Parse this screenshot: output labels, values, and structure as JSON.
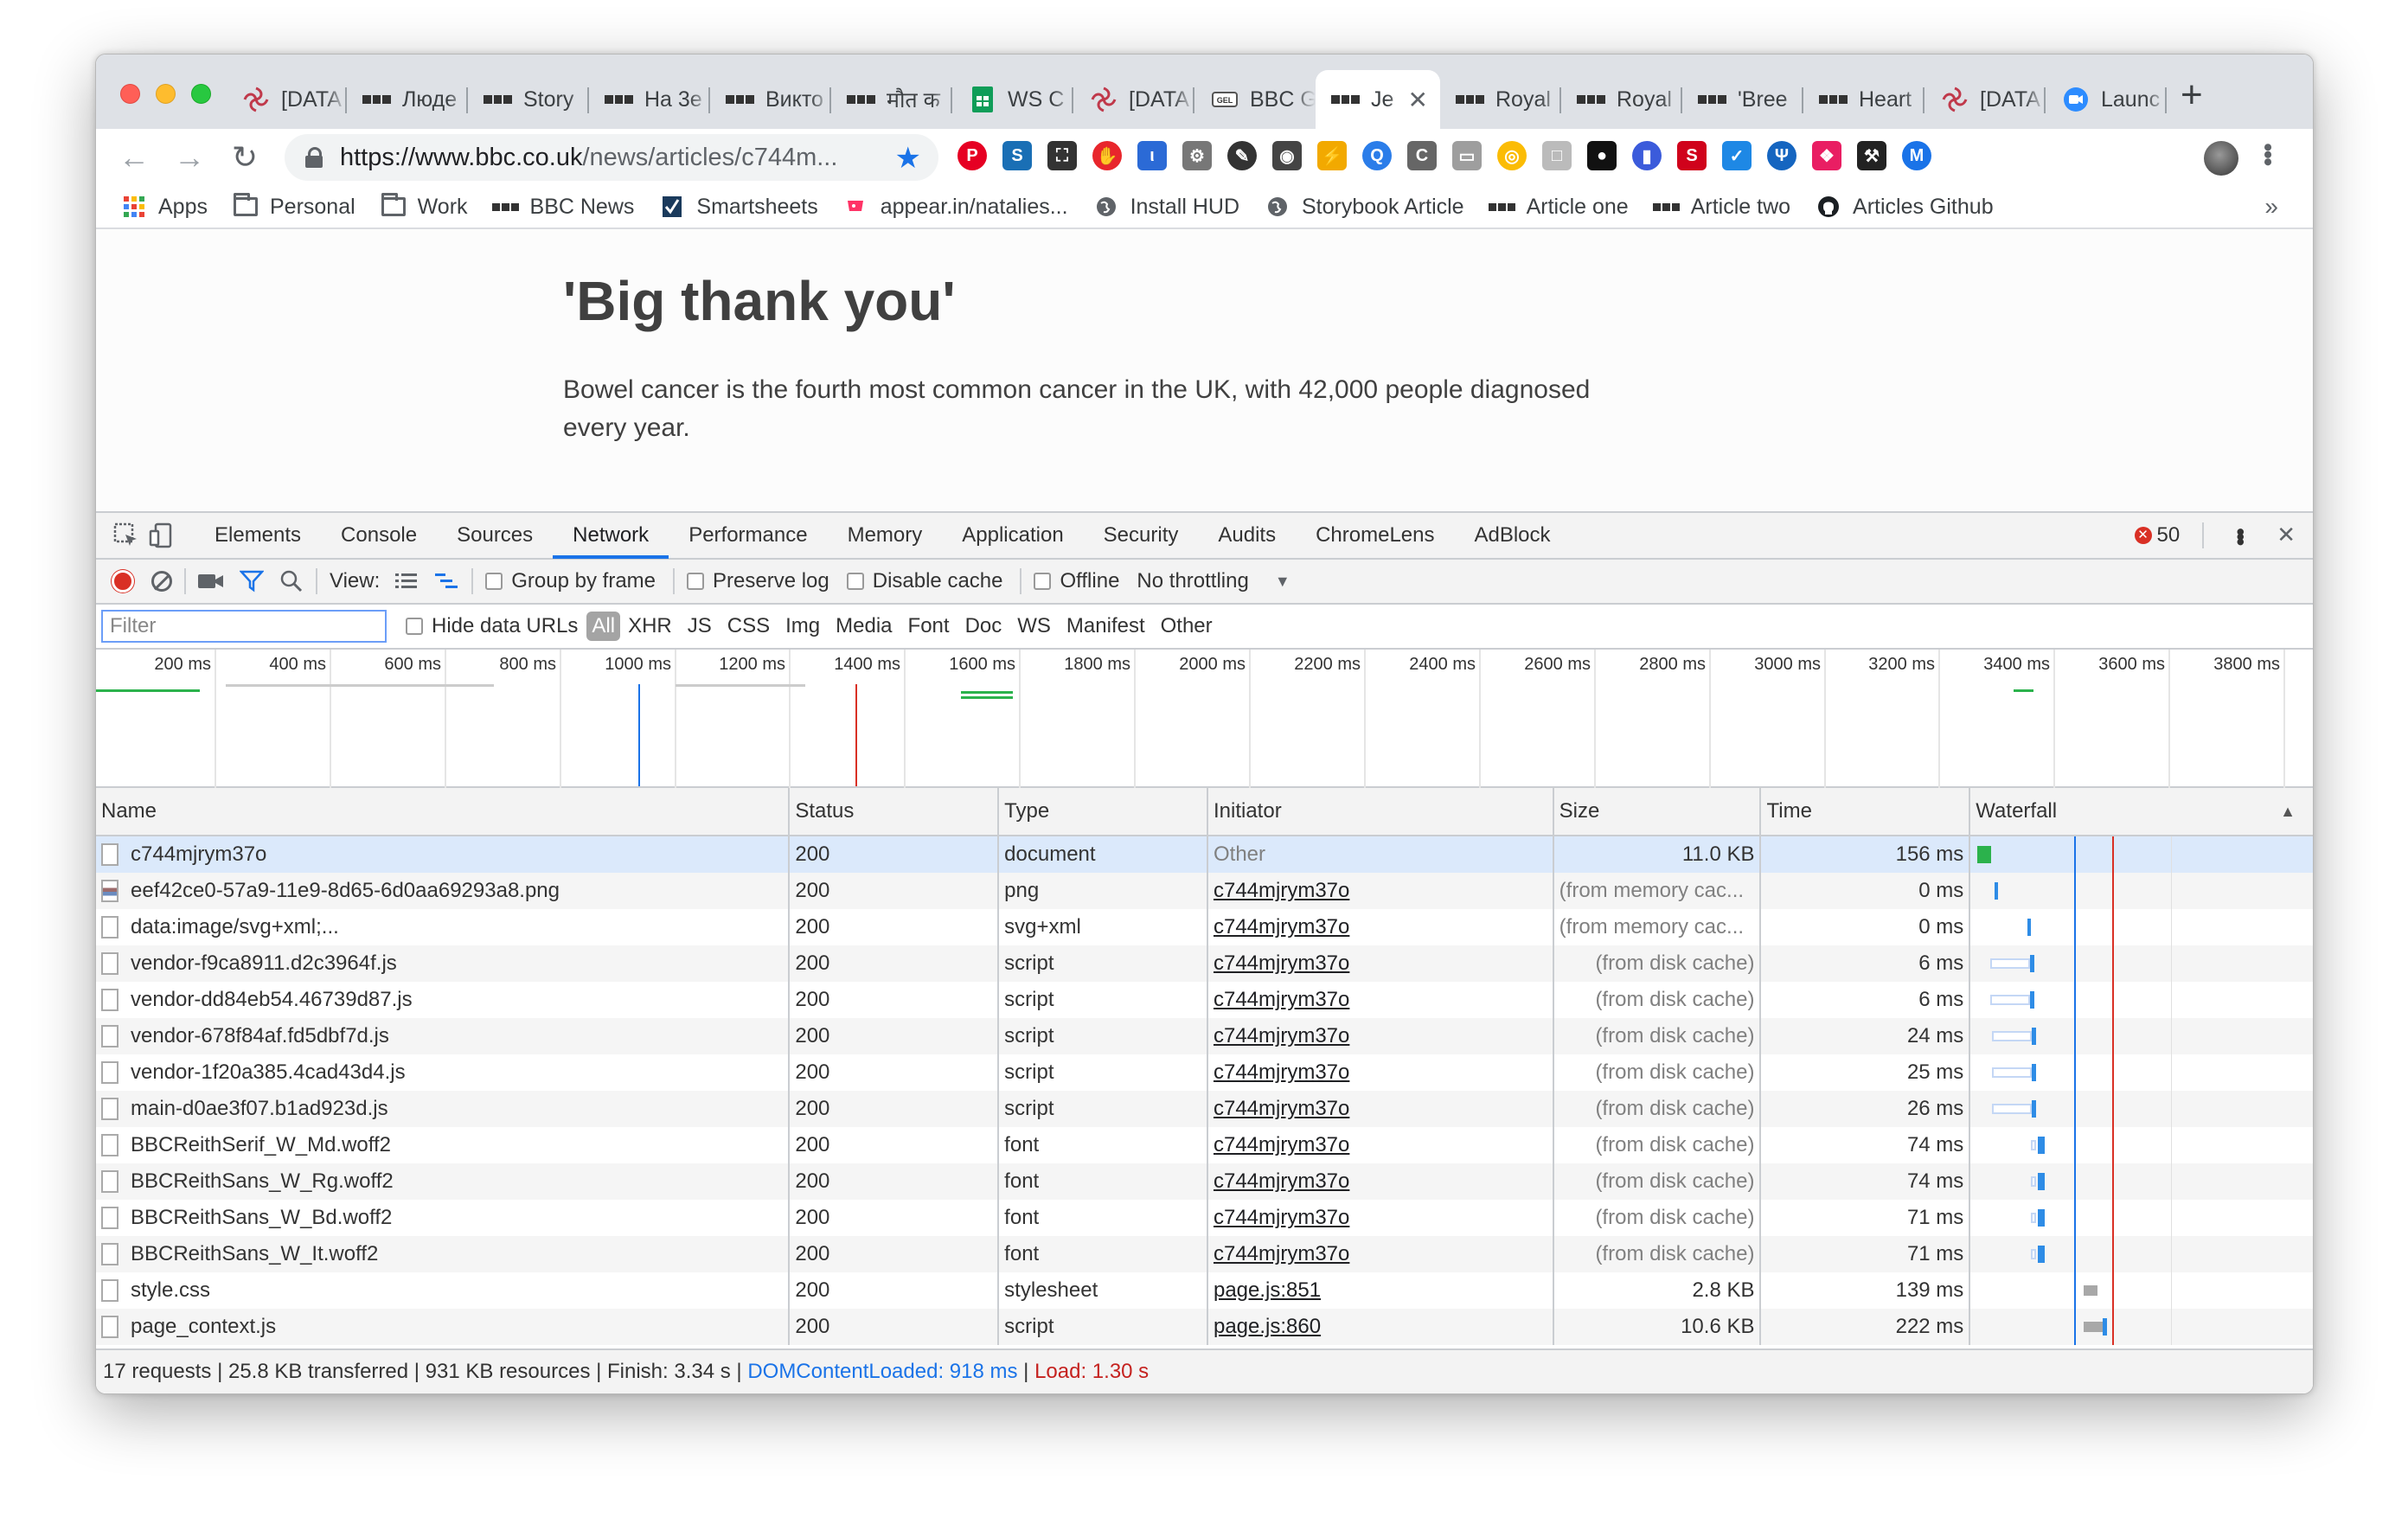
{
  "window": {
    "tabs": [
      {
        "title": "[DATA",
        "favicon": "swirl-icon",
        "color": "#c0394b"
      },
      {
        "title": "Люде",
        "favicon": "bbc-icon"
      },
      {
        "title": "Story",
        "favicon": "bbc-icon"
      },
      {
        "title": "На 3е",
        "favicon": "bbc-icon"
      },
      {
        "title": "Викто",
        "favicon": "bbc-icon"
      },
      {
        "title": "मौत क",
        "favicon": "bbc-icon"
      },
      {
        "title": "WS C",
        "favicon": "sheets-icon",
        "color": "#0f9d58"
      },
      {
        "title": "[DATA",
        "favicon": "swirl-icon",
        "color": "#c0394b"
      },
      {
        "title": "BBC G",
        "favicon": "gel-icon"
      },
      {
        "title": "Je",
        "favicon": "bbc-icon",
        "active": true
      },
      {
        "title": "Royal",
        "favicon": "bbc-icon"
      },
      {
        "title": "Royal",
        "favicon": "bbc-icon"
      },
      {
        "title": "'Bree",
        "favicon": "bbc-icon"
      },
      {
        "title": "Heart",
        "favicon": "bbc-icon"
      },
      {
        "title": "[DATA",
        "favicon": "swirl-icon",
        "color": "#c0394b"
      },
      {
        "title": "Launc",
        "favicon": "zoom-icon",
        "color": "#2d8cff"
      }
    ],
    "new_tab": "+"
  },
  "toolbar": {
    "back": "←",
    "forward": "→",
    "reload": "↻",
    "url_host": "https://www.bbc.co.uk",
    "url_path": "/news/articles/c744m...",
    "star": "★",
    "extensions": [
      {
        "name": "pinterest-icon",
        "color": "#e60023",
        "glyph": "P"
      },
      {
        "name": "s-extension-icon",
        "color": "#1a6fb5",
        "glyph": "S"
      },
      {
        "name": "screenshot-icon",
        "color": "#333333",
        "glyph": "⛶"
      },
      {
        "name": "adblock-hand-icon",
        "color": "#e8262c",
        "glyph": "✋"
      },
      {
        "name": "lang-extension-icon",
        "color": "#2b6ad6",
        "glyph": "ι"
      },
      {
        "name": "gear-extension-icon",
        "color": "#777777",
        "glyph": "⚙"
      },
      {
        "name": "eyedropper-icon",
        "color": "#333333",
        "glyph": "✎"
      },
      {
        "name": "incognito-icon",
        "color": "#444444",
        "glyph": "◉"
      },
      {
        "name": "lightning-icon",
        "color": "#f2a900",
        "glyph": "⚡"
      },
      {
        "name": "search-extension-icon",
        "color": "#2b7de9",
        "glyph": "Q"
      },
      {
        "name": "c-extension-icon",
        "color": "#666666",
        "glyph": "C"
      },
      {
        "name": "chat-extension-icon",
        "color": "#9e9e9e",
        "glyph": "▭"
      },
      {
        "name": "chrome-icon",
        "color": "#fbbc05",
        "glyph": "◎"
      },
      {
        "name": "box-extension-icon",
        "color": "#bbbbbb",
        "glyph": "□"
      },
      {
        "name": "mask-extension-icon",
        "color": "#111111",
        "glyph": "●"
      },
      {
        "name": "bookmark-flag-icon",
        "color": "#3b5bdb",
        "glyph": "▮"
      },
      {
        "name": "seo-icon",
        "color": "#d0021b",
        "glyph": "S"
      },
      {
        "name": "check-circle-icon",
        "color": "#1e88e5",
        "glyph": "✓"
      },
      {
        "name": "tree-extension-icon",
        "color": "#1565c0",
        "glyph": "Ψ"
      },
      {
        "name": "color-wheel-icon",
        "color": "#e91e63",
        "glyph": "❖"
      },
      {
        "name": "fork-extension-icon",
        "color": "#222222",
        "glyph": "⚒"
      },
      {
        "name": "m-extension-icon",
        "color": "#1a73e8",
        "glyph": "M"
      }
    ]
  },
  "bookmarks": [
    {
      "label": "Apps",
      "icon": "apps-grid-icon"
    },
    {
      "label": "Personal",
      "icon": "folder-icon"
    },
    {
      "label": "Work",
      "icon": "folder-icon"
    },
    {
      "label": "BBC News",
      "icon": "bbc-icon"
    },
    {
      "label": "Smartsheets",
      "icon": "smartsheet-icon"
    },
    {
      "label": "appear.in/natalies...",
      "icon": "appear-in-icon"
    },
    {
      "label": "Install HUD",
      "icon": "globe-icon"
    },
    {
      "label": "Storybook Article",
      "icon": "globe-icon"
    },
    {
      "label": "Article one",
      "icon": "bbc-icon"
    },
    {
      "label": "Article two",
      "icon": "bbc-icon"
    },
    {
      "label": "Articles Github",
      "icon": "github-icon"
    }
  ],
  "bookmarks_more": "»",
  "page": {
    "headline": "'Big thank you'",
    "paragraph": "Bowel cancer is the fourth most common cancer in the UK, with 42,000 people diagnosed every year."
  },
  "devtools": {
    "tabs": [
      "Elements",
      "Console",
      "Sources",
      "Network",
      "Performance",
      "Memory",
      "Application",
      "Security",
      "Audits",
      "ChromeLens",
      "AdBlock"
    ],
    "active_tab": "Network",
    "error_count": "50",
    "error_glyph": "✕",
    "close": "✕",
    "view_label": "View:",
    "options": {
      "group_by_frame": "Group by frame",
      "preserve_log": "Preserve log",
      "disable_cache": "Disable cache",
      "offline": "Offline",
      "throttling": "No throttling"
    },
    "filter_placeholder": "Filter",
    "hide_data_urls": "Hide data URLs",
    "filter_types": [
      "All",
      "XHR",
      "JS",
      "CSS",
      "Img",
      "Media",
      "Font",
      "Doc",
      "WS",
      "Manifest",
      "Other"
    ],
    "overview_ticks": [
      "200 ms",
      "400 ms",
      "600 ms",
      "800 ms",
      "1000 ms",
      "1200 ms",
      "1400 ms",
      "1600 ms",
      "1800 ms",
      "2000 ms",
      "2200 ms",
      "2400 ms",
      "2600 ms",
      "2800 ms",
      "3000 ms",
      "3200 ms",
      "3400 ms",
      "3600 ms",
      "3800 ms"
    ],
    "columns": [
      "Name",
      "Status",
      "Type",
      "Initiator",
      "Size",
      "Time",
      "Waterfall"
    ],
    "sort_glyph": "▲",
    "rows": [
      {
        "name": "c744mjrym37o",
        "status": "200",
        "type": "document",
        "initiator": "Other",
        "size": "11.0 KB",
        "time": "156 ms",
        "initiator_link": false,
        "icon": "file-icon",
        "wf_start": 0.0,
        "wf_end": 0.0395,
        "wf_color": "#2bb24c"
      },
      {
        "name": "eef42ce0-57a9-11e9-8d65-6d0aa69293a8.png",
        "status": "200",
        "type": "png",
        "initiator": "c744mjrym37o",
        "size": "(from memory cac...",
        "time": "0 ms",
        "initiator_link": true,
        "icon": "image-file-icon",
        "wf_start": 0.0505,
        "wf_end": 0.0515,
        "wf_color": "#2e8ce6"
      },
      {
        "name": "data:image/svg+xml;...",
        "status": "200",
        "type": "svg+xml",
        "initiator": "c744mjrym37o",
        "size": "(from memory cac...",
        "time": "0 ms",
        "initiator_link": true,
        "icon": "file-icon",
        "wf_start": 0.146,
        "wf_end": 0.147,
        "wf_color": "#2e8ce6"
      },
      {
        "name": "vendor-f9ca8911.d2c3964f.js",
        "status": "200",
        "type": "script",
        "initiator": "c744mjrym37o",
        "size": "(from disk cache)",
        "time": "6 ms",
        "initiator_link": true,
        "icon": "file-icon",
        "wf_start": 0.154,
        "wf_end": 0.155,
        "wf_color": "#2e8ce6"
      },
      {
        "name": "vendor-dd84eb54.46739d87.js",
        "status": "200",
        "type": "script",
        "initiator": "c744mjrym37o",
        "size": "(from disk cache)",
        "time": "6 ms",
        "initiator_link": true,
        "icon": "file-icon",
        "wf_start": 0.154,
        "wf_end": 0.155,
        "wf_color": "#2e8ce6"
      },
      {
        "name": "vendor-678f84af.fd5dbf7d.js",
        "status": "200",
        "type": "script",
        "initiator": "c744mjrym37o",
        "size": "(from disk cache)",
        "time": "24 ms",
        "initiator_link": true,
        "icon": "file-icon",
        "wf_start": 0.16,
        "wf_end": 0.166,
        "wf_color": "#2e8ce6"
      },
      {
        "name": "vendor-1f20a385.4cad43d4.js",
        "status": "200",
        "type": "script",
        "initiator": "c744mjrym37o",
        "size": "(from disk cache)",
        "time": "25 ms",
        "initiator_link": true,
        "icon": "file-icon",
        "wf_start": 0.16,
        "wf_end": 0.166,
        "wf_color": "#2e8ce6"
      },
      {
        "name": "main-d0ae3f07.b1ad923d.js",
        "status": "200",
        "type": "script",
        "initiator": "c744mjrym37o",
        "size": "(from disk cache)",
        "time": "26 ms",
        "initiator_link": true,
        "icon": "file-icon",
        "wf_start": 0.16,
        "wf_end": 0.166,
        "wf_color": "#2e8ce6"
      },
      {
        "name": "BBCReithSerif_W_Md.woff2",
        "status": "200",
        "type": "font",
        "initiator": "c744mjrym37o",
        "size": "(from disk cache)",
        "time": "74 ms",
        "initiator_link": true,
        "icon": "file-icon",
        "wf_start": 0.166,
        "wf_end": 0.185,
        "wf_color": "#2e8ce6"
      },
      {
        "name": "BBCReithSans_W_Rg.woff2",
        "status": "200",
        "type": "font",
        "initiator": "c744mjrym37o",
        "size": "(from disk cache)",
        "time": "74 ms",
        "initiator_link": true,
        "icon": "file-icon",
        "wf_start": 0.166,
        "wf_end": 0.185,
        "wf_color": "#2e8ce6"
      },
      {
        "name": "BBCReithSans_W_Bd.woff2",
        "status": "200",
        "type": "font",
        "initiator": "c744mjrym37o",
        "size": "(from disk cache)",
        "time": "71 ms",
        "initiator_link": true,
        "icon": "file-icon",
        "wf_start": 0.166,
        "wf_end": 0.184,
        "wf_color": "#2e8ce6"
      },
      {
        "name": "BBCReithSans_W_It.woff2",
        "status": "200",
        "type": "font",
        "initiator": "c744mjrym37o",
        "size": "(from disk cache)",
        "time": "71 ms",
        "initiator_link": true,
        "icon": "file-icon",
        "wf_start": 0.166,
        "wf_end": 0.184,
        "wf_color": "#2e8ce6"
      },
      {
        "name": "style.css",
        "status": "200",
        "type": "stylesheet",
        "initiator": "page.js:851",
        "size": "2.8 KB",
        "time": "139 ms",
        "initiator_link": true,
        "icon": "file-icon",
        "wf_start": 0.31,
        "wf_end": 0.345,
        "wf_color": "#a8a8a8"
      },
      {
        "name": "page_context.js",
        "status": "200",
        "type": "script",
        "initiator": "page.js:860",
        "size": "10.6 KB",
        "time": "222 ms",
        "initiator_link": true,
        "icon": "file-icon",
        "wf_start": 0.31,
        "wf_end": 0.368,
        "wf_color": "#2e8ce6"
      }
    ],
    "status_bar": {
      "summary": "17 requests | 25.8 KB transferred | 931 KB resources | Finish: 3.34 s | ",
      "dom_content_loaded": "DOMContentLoaded: 918 ms",
      "divider": " | ",
      "load": "Load: 1.30 s",
      "dcl_color": "#1a73e8",
      "load_color": "#c5221f"
    }
  }
}
